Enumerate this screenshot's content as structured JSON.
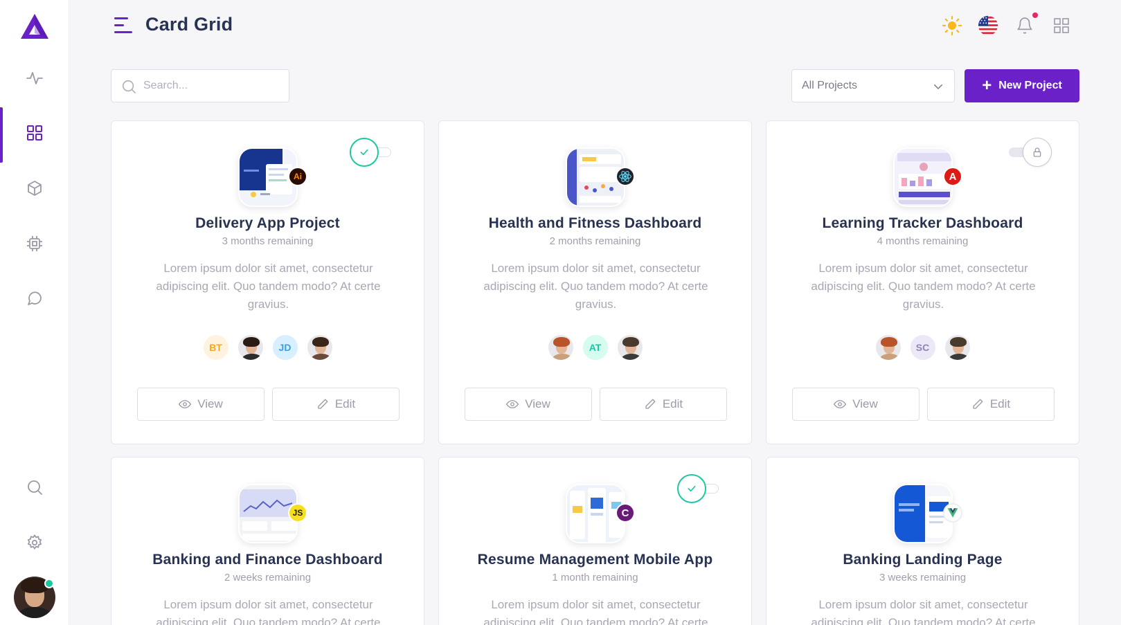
{
  "header": {
    "title": "Card Grid"
  },
  "toolbar": {
    "search_placeholder": "Search...",
    "filter_selected": "All Projects",
    "new_project_label": "New Project"
  },
  "colors": {
    "accent": "#6b21c8",
    "success": "#1cc8a0",
    "danger": "#e62965"
  },
  "sidebar": {
    "items": [
      {
        "icon": "activity-icon"
      },
      {
        "icon": "grid-icon",
        "active": true
      },
      {
        "icon": "box-icon"
      },
      {
        "icon": "cpu-icon"
      },
      {
        "icon": "message-icon"
      },
      {
        "icon": "search-icon"
      },
      {
        "icon": "settings-icon"
      }
    ]
  },
  "cards": [
    {
      "title": "Delivery App Project",
      "remaining": "3 months remaining",
      "description": "Lorem ipsum dolor sit amet, consectetur adipiscing elit. Quo tandem modo? At certe gravius.",
      "badge": "Ai",
      "status": "done",
      "avatars": [
        "BT",
        "",
        "JD",
        ""
      ],
      "view_label": "View",
      "edit_label": "Edit"
    },
    {
      "title": "Health and Fitness Dashboard",
      "remaining": "2 months remaining",
      "description": "Lorem ipsum dolor sit amet, consectetur adipiscing elit. Quo tandem modo? At certe gravius.",
      "badge": "react",
      "status": "none",
      "avatars": [
        "",
        "AT",
        ""
      ],
      "view_label": "View",
      "edit_label": "Edit"
    },
    {
      "title": "Learning Tracker Dashboard",
      "remaining": "4 months remaining",
      "description": "Lorem ipsum dolor sit amet, consectetur adipiscing elit. Quo tandem modo? At certe gravius.",
      "badge": "A",
      "status": "locked",
      "avatars": [
        "",
        "SC",
        ""
      ],
      "view_label": "View",
      "edit_label": "Edit"
    },
    {
      "title": "Banking and Finance Dashboard",
      "remaining": "2 weeks remaining",
      "description": "Lorem ipsum dolor sit amet, consectetur adipiscing elit. Quo tandem modo? At certe gravius.",
      "badge": "JS",
      "status": "none"
    },
    {
      "title": "Resume Management Mobile App",
      "remaining": "1 month remaining",
      "description": "Lorem ipsum dolor sit amet, consectetur adipiscing elit. Quo tandem modo? At certe gravius.",
      "badge": "C",
      "status": "done"
    },
    {
      "title": "Banking Landing Page",
      "remaining": "3 weeks remaining",
      "description": "Lorem ipsum dolor sit amet, consectetur adipiscing elit. Quo tandem modo? At certe gravius.",
      "badge": "V",
      "status": "none"
    }
  ]
}
